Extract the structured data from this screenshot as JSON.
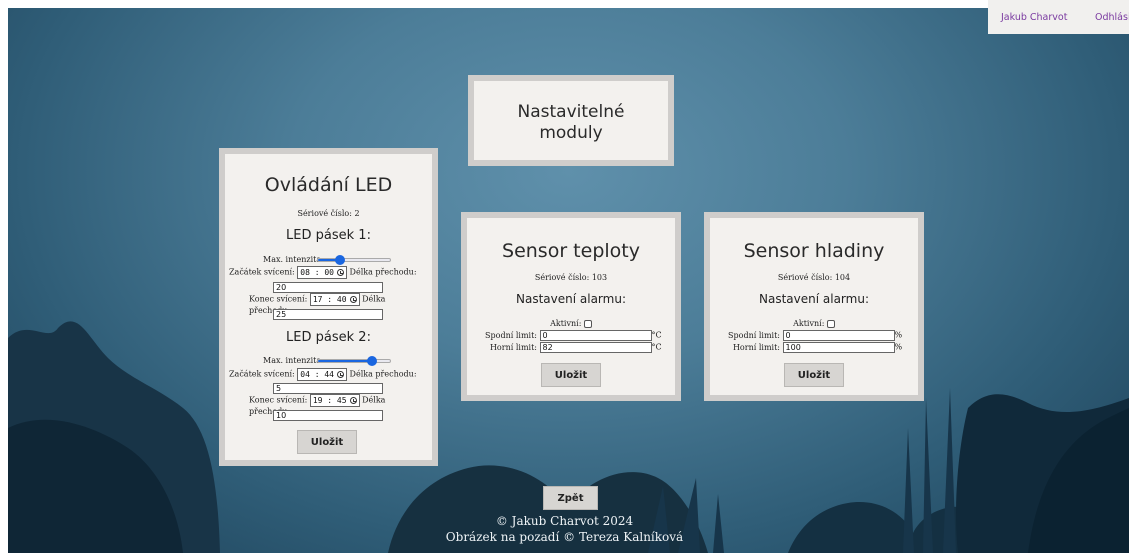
{
  "topbar": {
    "user": "Jakub Charvot",
    "logout": "Odhlásit"
  },
  "modules": {
    "title_line1": "Nastavitelné",
    "title_line2": "moduly"
  },
  "led": {
    "title": "Ovládání LED",
    "serial": "Sériové číslo: 2",
    "strip1": {
      "title": "LED pásek 1:",
      "max_label": "Max. intenzita:",
      "intensity": 0.3,
      "start_label": "Začátek svícení:",
      "start_time": "08 : 00",
      "transition_label": "Délka přechodu:",
      "start_transition": "20",
      "end_label": "Konec svícení:",
      "end_time": "17 : 40",
      "end_transition": "25"
    },
    "strip2": {
      "title": "LED pásek 2:",
      "max_label": "Max. intenzita:",
      "intensity": 0.75,
      "start_label": "Začátek svícení:",
      "start_time": "04 : 44",
      "transition_label": "Délka přechodu:",
      "start_transition": "5",
      "end_label": "Konec svícení:",
      "end_time": "19 : 45",
      "end_transition": "10"
    },
    "save": "Uložit"
  },
  "temp": {
    "title": "Sensor teploty",
    "serial": "Sériové číslo: 103",
    "alarm_title": "Nastavení alarmu:",
    "active_label": "Aktivní:",
    "low_label": "Spodní limit:",
    "low_value": "0",
    "high_label": "Horní limit:",
    "high_value": "82",
    "unit": "°C",
    "save": "Uložit"
  },
  "level": {
    "title": "Sensor hladiny",
    "serial": "Sériové číslo: 104",
    "alarm_title": "Nastavení alarmu:",
    "active_label": "Aktivní:",
    "low_label": "Spodní limit:",
    "low_value": "0",
    "high_label": "Horní limit:",
    "high_value": "100",
    "unit": "%",
    "save": "Uložit"
  },
  "back": "Zpět",
  "footer": {
    "copyright": "© Jakub Charvot 2024",
    "image_credit": "Obrázek na pozadí © Tereza Kalníková"
  }
}
